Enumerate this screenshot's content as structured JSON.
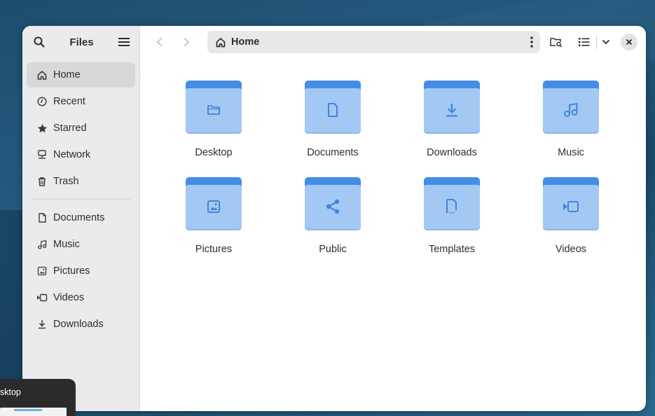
{
  "sidebar": {
    "title": "Files",
    "items": [
      {
        "label": "Home",
        "icon": "home-icon",
        "active": true
      },
      {
        "label": "Recent",
        "icon": "clock-icon"
      },
      {
        "label": "Starred",
        "icon": "star-icon"
      },
      {
        "label": "Network",
        "icon": "network-icon"
      },
      {
        "label": "Trash",
        "icon": "trash-icon"
      }
    ],
    "bookmarks": [
      {
        "label": "Documents",
        "icon": "document-icon"
      },
      {
        "label": "Music",
        "icon": "music-icon"
      },
      {
        "label": "Pictures",
        "icon": "picture-icon"
      },
      {
        "label": "Videos",
        "icon": "video-icon"
      },
      {
        "label": "Downloads",
        "icon": "download-icon"
      }
    ]
  },
  "header": {
    "path": "Home",
    "path_icon": "home-icon"
  },
  "folders": [
    {
      "label": "Desktop",
      "icon": "folder-glyph-icon"
    },
    {
      "label": "Documents",
      "icon": "document-icon"
    },
    {
      "label": "Downloads",
      "icon": "download-icon"
    },
    {
      "label": "Music",
      "icon": "music-icon"
    },
    {
      "label": "Pictures",
      "icon": "picture-icon"
    },
    {
      "label": "Public",
      "icon": "share-icon"
    },
    {
      "label": "Templates",
      "icon": "template-icon"
    },
    {
      "label": "Videos",
      "icon": "video-icon"
    }
  ],
  "taskbar": {
    "label": "sktop"
  },
  "colors": {
    "folder_light": "#a4c8f4",
    "folder_dark": "#438de6",
    "sidebar_bg": "#ebebed",
    "active_item": "#d8d8da"
  }
}
